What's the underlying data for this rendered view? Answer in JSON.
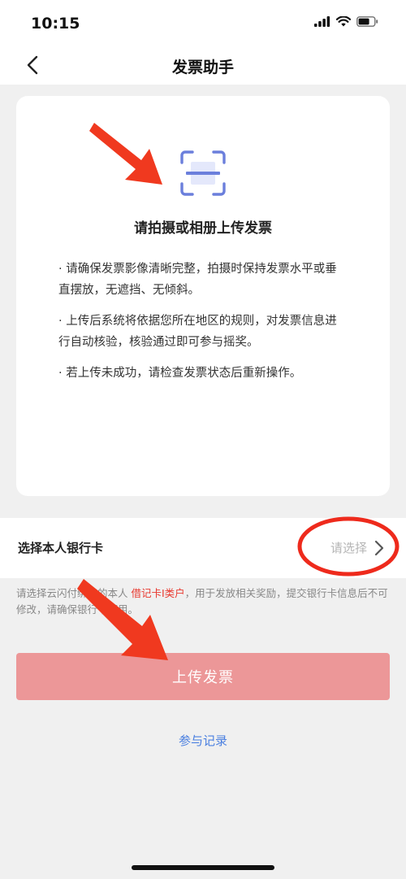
{
  "status_bar": {
    "time": "10:15"
  },
  "nav": {
    "title": "发票助手"
  },
  "card": {
    "title": "请拍摄或相册上传发票",
    "notes": [
      "· 请确保发票影像清晰完整，拍摄时保持发票水平或垂直摆放，无遮挡、无倾斜。",
      "· 上传后系统将依据您所在地区的规则，对发票信息进行自动核验，核验通过即可参与摇奖。",
      "· 若上传未成功，请检查发票状态后重新操作。"
    ]
  },
  "bank_card": {
    "label": "选择本人银行卡",
    "placeholder": "请选择"
  },
  "info": {
    "prefix": "请选择云闪付绑定的本人 ",
    "highlight": "借记卡Ⅰ类户",
    "suffix": "，用于发放相关奖励，提交银行卡信息后不可修改，请确保银行卡可用。"
  },
  "upload_button": {
    "label": "上传发票"
  },
  "record_link": {
    "label": "参与记录"
  },
  "colors": {
    "accent_red": "#e8382e",
    "button_bg": "#ec9798",
    "link_blue": "#4a7fe0",
    "scan_icon": "#6b7fdc"
  }
}
